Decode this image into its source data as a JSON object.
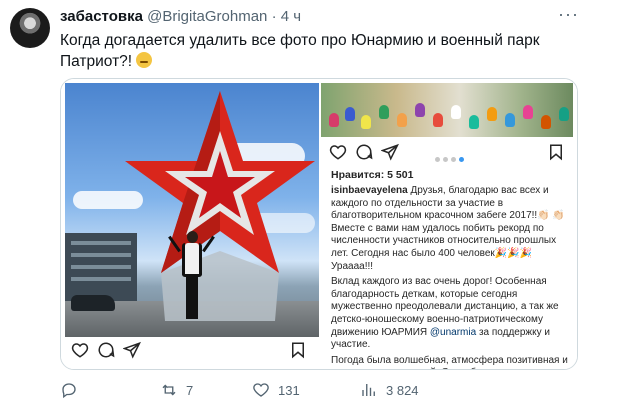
{
  "tweet": {
    "author_name": "забастовка",
    "author_handle": "@BrigitaGrohman",
    "separator": "·",
    "time": "4 ч",
    "text": "Когда догадается удалить все фото про Юнармию и военный парк Патриот?!",
    "emoji_icon": "thinking-face-icon"
  },
  "instagram_right": {
    "likes": "Нравится: 5 501",
    "username": "isinbaevayelena",
    "caption_p1": "Друзья, благодарю вас всех и каждого по отдельности за участие в благотворительном красочном забеге 2017!!👏🏻 👏🏻 Вместе с вами нам удалось побить рекорд по численности участников относительно прошлых лет. Сегодня нас было 400 человек🎉🎉🎉 Ураааа!!!",
    "caption_p2_a": "Вклад каждого из вас очень дорог! Особенная благодарность деткам, которые сегодня мужественно преодолевали дистанцию, а так же детско-юношескому военно-патриотическому движению ЮАРМИЯ ",
    "caption_mention": "@unarmia",
    "caption_p2_b": " за поддержку и участие.",
    "caption_p3": "Погода была волшебная, атмосфера позитивная и заряжающая энергией. Спасибо вам всем за мотивацию продолжать творить и совершенствовать наш город и спортивные"
  },
  "actions": {
    "reply_count": "",
    "retweet_count": "7",
    "like_count": "131",
    "views_count": "3 824"
  },
  "icons": {
    "more": "more-icon",
    "heart": "heart-icon",
    "comment": "comment-icon",
    "send": "send-icon",
    "bookmark": "bookmark-icon",
    "reply": "reply-icon",
    "retweet": "retweet-icon",
    "like": "like-icon",
    "views": "views-icon"
  },
  "colors": {
    "text": "#0f1419",
    "muted": "#536471",
    "star_red": "#d9261c",
    "carousel_active": "#3897f0"
  }
}
